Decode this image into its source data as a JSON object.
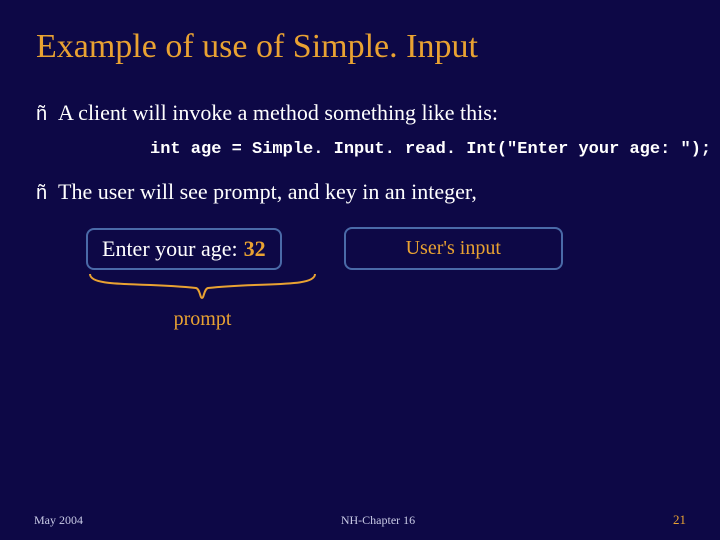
{
  "title": "Example of use of Simple. Input",
  "bullets": [
    "A client will invoke a method something like this:",
    "The user will see prompt, and key in an integer,"
  ],
  "code_line": "int age = Simple. Input. read. Int(\"Enter your age: \");",
  "example": {
    "prompt_text": "Enter your age:",
    "user_value": "32",
    "user_input_label": "User's input",
    "prompt_label": "prompt"
  },
  "footer": {
    "left": "May 2004",
    "center": "NH-Chapter 16",
    "right": "21"
  },
  "bullet_glyph": "ñ"
}
